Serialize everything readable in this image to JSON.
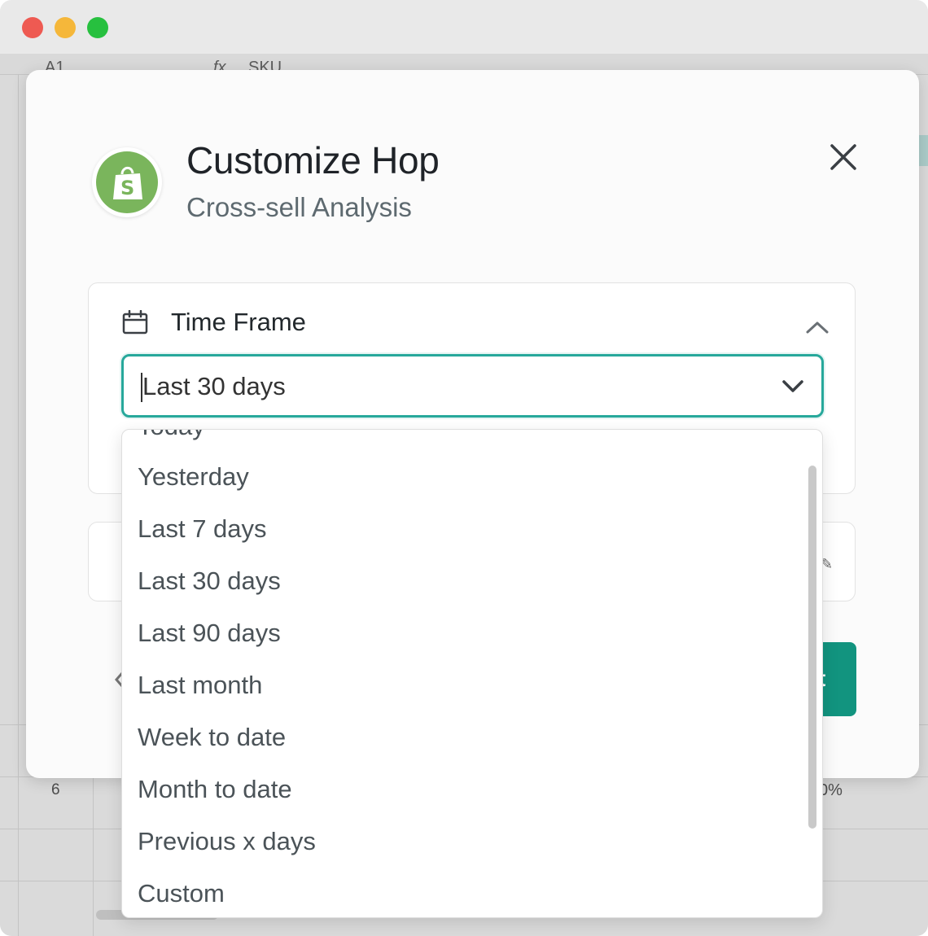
{
  "window": {
    "controls": [
      "close",
      "minimize",
      "maximize"
    ]
  },
  "spreadsheet": {
    "cell_ref": "A1",
    "fx": "fx",
    "formula_value": "SKU",
    "row_label": "6",
    "partial_value": "0%"
  },
  "modal": {
    "title": "Customize Hop",
    "subtitle": "Cross-sell Analysis",
    "close_icon": "close-icon",
    "logo_icon": "shopify-bag-icon"
  },
  "time_frame": {
    "label": "Time Frame",
    "selected": "Last 30 days",
    "options": [
      "Today",
      "Yesterday",
      "Last 7 days",
      "Last 30 days",
      "Last 90 days",
      "Last month",
      "Week to date",
      "Month to date",
      "Previous x days",
      "Custom"
    ]
  },
  "footer": {
    "primary_label": "t"
  },
  "colors": {
    "accent": "#27a89b",
    "primary_button": "#12947f",
    "shopify_green": "#7ab55c"
  }
}
